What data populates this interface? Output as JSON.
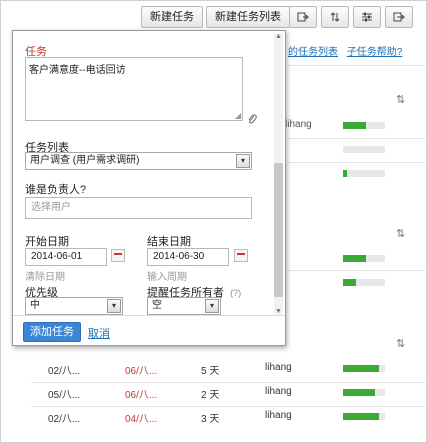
{
  "toolbar": {
    "new_task": "新建任务",
    "new_task_list": "新建任务列表"
  },
  "top_links": {
    "task_list": "的任务列表",
    "subtask_help": "子任务帮助?"
  },
  "bg_user": "lihang",
  "bg_bars": [
    0.55,
    0.0,
    0.1,
    0.55,
    0.3
  ],
  "rows": [
    {
      "c1": "02/八...",
      "c2": "06/八...",
      "c3": "5 天",
      "c4": "lihang",
      "progress": 0.85
    },
    {
      "c1": "05/八...",
      "c2": "06/八...",
      "c3": "2 天",
      "c4": "lihang",
      "progress": 0.75
    },
    {
      "c1": "02/八...",
      "c2": "04/八...",
      "c3": "3 天",
      "c4": "lihang",
      "progress": 0.85
    }
  ],
  "dialog": {
    "task_label": "任务",
    "task_value": "客户满意度--电话回访",
    "list_label": "任务列表",
    "list_value": "用户调查 (用户需求调研)",
    "owner_label": "谁是负责人?",
    "owner_placeholder": "选择用户",
    "start_label": "开始日期",
    "start_value": "2014-06-01",
    "clear_date": "清除日期",
    "end_label": "结束日期",
    "end_value": "2014-06-30",
    "enter_period": "输入周期",
    "priority_label": "优先级",
    "priority_value": "中",
    "remind_label": "提醒任务所有者",
    "remind_help": "(?)",
    "remind_value": "空",
    "add_button": "添加任务",
    "cancel": "取消"
  },
  "colors": {
    "accent": "#3c86d8",
    "required": "#c0392b",
    "progress": "#3aaa35"
  }
}
